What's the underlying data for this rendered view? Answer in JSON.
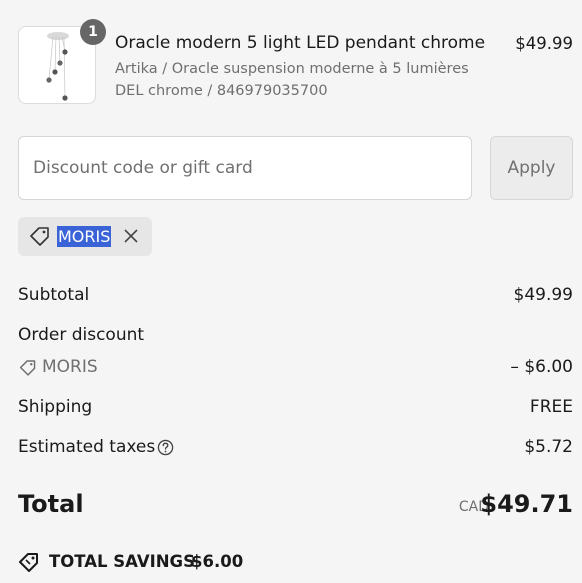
{
  "product": {
    "quantity": "1",
    "title": "Oracle modern 5 light LED pendant chrome",
    "subtitle": "Artika / Oracle suspension moderne à 5 lumières DEL chrome / 846979035700",
    "price": "$49.99",
    "image_icon": "pendant-light-thumbnail"
  },
  "discount": {
    "placeholder": "Discount code or gift card",
    "apply_label": "Apply",
    "applied_code": "MORIS"
  },
  "summary": {
    "subtotal_label": "Subtotal",
    "subtotal_value": "$49.99",
    "order_discount_label": "Order discount",
    "discount_code": "MORIS",
    "discount_value": "– $6.00",
    "shipping_label": "Shipping",
    "shipping_value": "FREE",
    "taxes_label": "Estimated taxes",
    "taxes_value": "$5.72"
  },
  "total": {
    "label": "Total",
    "currency": "CAD",
    "value": "$49.71"
  },
  "savings": {
    "label": "TOTAL SAVINGS",
    "value": "$6.00"
  },
  "colors": {
    "background": "#f5f5f5",
    "selection": "#3b63d8",
    "muted_text": "#6f6f6f"
  }
}
